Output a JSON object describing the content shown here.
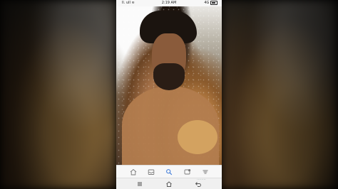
{
  "status_bar": {
    "left_text": "ll. ull ≋",
    "time": "2:19 AM",
    "right_text": "4G"
  },
  "toolbar": {
    "icons": [
      "home-icon",
      "inbox-icon",
      "search-icon",
      "share-icon",
      "layers-icon"
    ],
    "accent": "#3f7bd9"
  },
  "navbar": {
    "icons": [
      "menu-icon",
      "home-icon",
      "back-icon"
    ]
  },
  "watermark": "........"
}
